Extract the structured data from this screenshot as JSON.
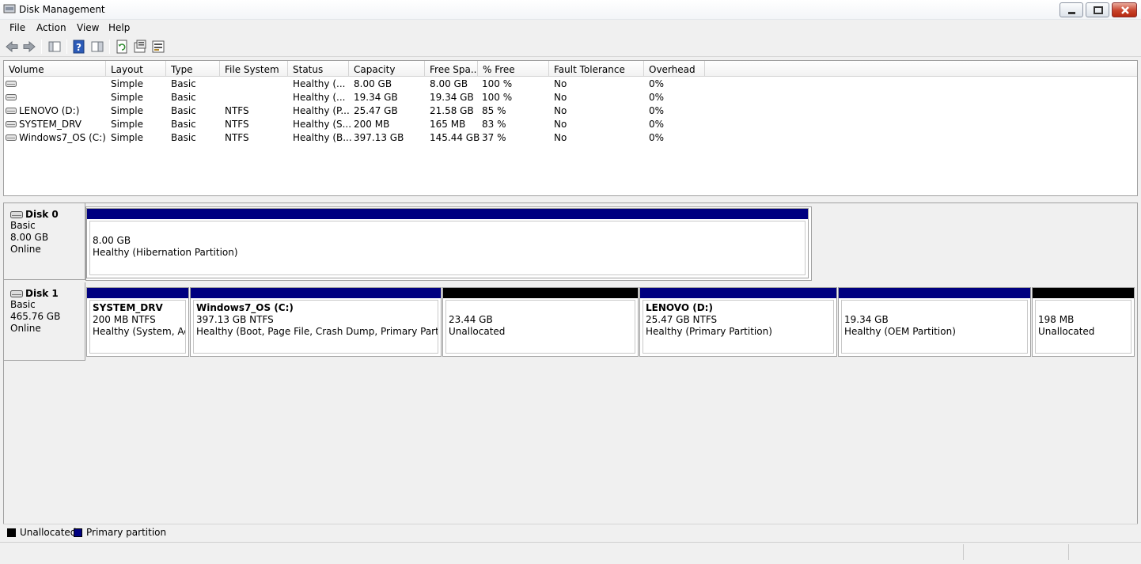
{
  "window": {
    "title": "Disk Management"
  },
  "menu": [
    "File",
    "Action",
    "View",
    "Help"
  ],
  "toolbar": [
    "back-icon",
    "forward-icon",
    "console-tree-icon",
    "help-icon",
    "show-hide-icon",
    "refresh-icon",
    "properties-icon",
    "rescan-icon"
  ],
  "volume_list": {
    "columns": [
      "Volume",
      "Layout",
      "Type",
      "File System",
      "Status",
      "Capacity",
      "Free Spa...",
      "% Free",
      "Fault Tolerance",
      "Overhead"
    ],
    "rows": [
      {
        "volume": "",
        "layout": "Simple",
        "type": "Basic",
        "fs": "",
        "status": "Healthy (...",
        "capacity": "8.00 GB",
        "free": "8.00 GB",
        "pct": "100 %",
        "fault": "No",
        "overhead": "0%"
      },
      {
        "volume": "",
        "layout": "Simple",
        "type": "Basic",
        "fs": "",
        "status": "Healthy (...",
        "capacity": "19.34 GB",
        "free": "19.34 GB",
        "pct": "100 %",
        "fault": "No",
        "overhead": "0%"
      },
      {
        "volume": "LENOVO (D:)",
        "layout": "Simple",
        "type": "Basic",
        "fs": "NTFS",
        "status": "Healthy (P...",
        "capacity": "25.47 GB",
        "free": "21.58 GB",
        "pct": "85 %",
        "fault": "No",
        "overhead": "0%"
      },
      {
        "volume": "SYSTEM_DRV",
        "layout": "Simple",
        "type": "Basic",
        "fs": "NTFS",
        "status": "Healthy (S...",
        "capacity": "200 MB",
        "free": "165 MB",
        "pct": "83 %",
        "fault": "No",
        "overhead": "0%"
      },
      {
        "volume": "Windows7_OS (C:)",
        "layout": "Simple",
        "type": "Basic",
        "fs": "NTFS",
        "status": "Healthy (B...",
        "capacity": "397.13 GB",
        "free": "145.44 GB",
        "pct": "37 %",
        "fault": "No",
        "overhead": "0%"
      }
    ]
  },
  "disks": [
    {
      "name": "Disk 0",
      "type": "Basic",
      "size": "8.00 GB",
      "state": "Online",
      "partitions": [
        {
          "name": "",
          "line1": "8.00 GB",
          "line2": "Healthy (Hibernation Partition)",
          "kind": "primary"
        }
      ]
    },
    {
      "name": "Disk 1",
      "type": "Basic",
      "size": "465.76 GB",
      "state": "Online",
      "partitions": [
        {
          "name": "SYSTEM_DRV",
          "line1": "200 MB NTFS",
          "line2": "Healthy (System, Activ",
          "kind": "primary"
        },
        {
          "name": "Windows7_OS  (C:)",
          "line1": "397.13 GB NTFS",
          "line2": "Healthy (Boot, Page File, Crash Dump, Primary Partition)",
          "kind": "primary"
        },
        {
          "name": "",
          "line1": "23.44 GB",
          "line2": "Unallocated",
          "kind": "unallocated"
        },
        {
          "name": "LENOVO  (D:)",
          "line1": "25.47 GB NTFS",
          "line2": "Healthy (Primary Partition)",
          "kind": "primary"
        },
        {
          "name": "",
          "line1": "19.34 GB",
          "line2": "Healthy (OEM Partition)",
          "kind": "primary"
        },
        {
          "name": "",
          "line1": "198 MB",
          "line2": "Unallocated",
          "kind": "unallocated"
        }
      ]
    }
  ],
  "legend": [
    {
      "label": "Unallocated",
      "color": "#000000"
    },
    {
      "label": "Primary partition",
      "color": "#000080"
    }
  ],
  "colors": {
    "primary": "#000080",
    "unallocated": "#000000"
  }
}
